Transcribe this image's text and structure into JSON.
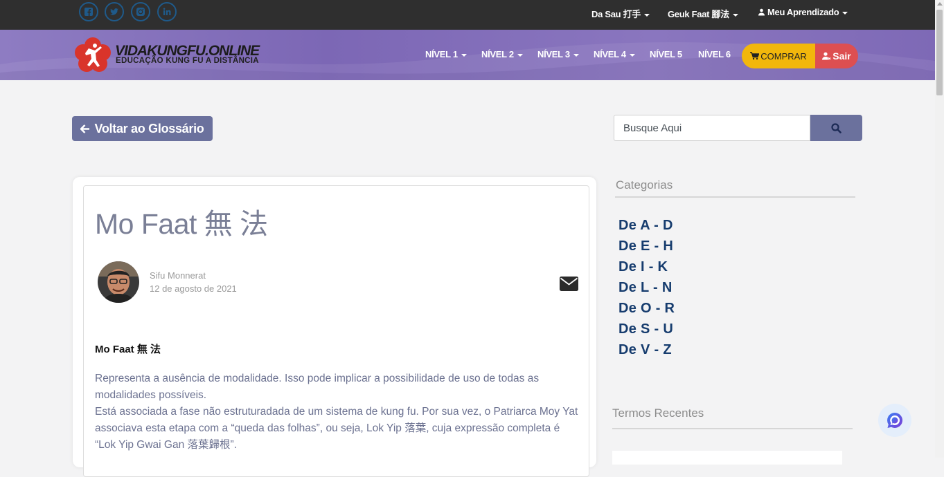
{
  "topbar": {
    "social": [
      "facebook-icon",
      "twitter-icon",
      "instagram-icon",
      "linkedin-icon"
    ],
    "menus": [
      {
        "label": "Da Sau 打手"
      },
      {
        "label": "Geuk Faat 腳法"
      },
      {
        "label": "Meu Aprendizado"
      }
    ]
  },
  "header": {
    "logo_title": "VIDAKUNGFU.ONLINE",
    "logo_subtitle": "EDUCAÇÃO KUNG FU A DISTÂNCIA",
    "nav": [
      "NÍVEL 1",
      "NÍVEL 2",
      "NÍVEL 3",
      "NÍVEL 4",
      "NÍVEL 5",
      "NÍVEL 6"
    ],
    "comprar": "COMPRAR",
    "sair": "Sair"
  },
  "toolbar": {
    "back_label": "Voltar ao Glossário",
    "search_placeholder": "Busque Aqui"
  },
  "post": {
    "title": "Mo Faat 無 法",
    "author": "Sifu Monnerat",
    "date": "12 de agosto de 2021",
    "heading": "Mo Faat 無 法",
    "paragraphs": [
      "Representa a ausência de modalidade. Isso pode implicar a possibilidade de uso de todas as modalidades possíveis.",
      "Está associada a fase não estruturadada de um sistema de kung fu. Por sua vez, o Patriarca Moy Yat associava esta etapa com a “queda das folhas”, ou seja, Lok Yip 落葉, cuja expressão completa é “Lok Yip Gwai Gan 落葉歸根”."
    ]
  },
  "sidebar": {
    "categories_title": "Categorias",
    "categories": [
      "De A - D",
      "De E - H",
      "De I - K",
      "De L - N",
      "De O - R",
      "De S - U",
      "De V - Z"
    ],
    "recent_title": "Termos Recentes"
  },
  "colors": {
    "topbar": "#2f2f2f",
    "navbar": "#7c67b5",
    "comprar": "#f2b70c",
    "sair": "#dd4f51",
    "button": "#6b719d",
    "category_link": "#163c6e"
  }
}
